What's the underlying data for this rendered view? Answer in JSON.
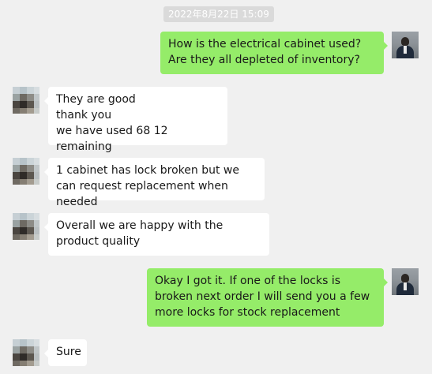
{
  "chat": {
    "timestamp": "2022年8月22日 15:09",
    "messages": [
      {
        "from": "self",
        "text": "How is the electrical cabinet used? Are they all depleted of inventory?"
      },
      {
        "from": "contact",
        "text": "They are good\nthank you\nwe have used 68 12 remaining"
      },
      {
        "from": "contact",
        "text": "1 cabinet has lock broken but we can request replacement when needed"
      },
      {
        "from": "contact",
        "text": "Overall we are happy with the product quality"
      },
      {
        "from": "self",
        "text": "Okay I got it. If one of the locks is broken next order I will send you a few more locks for stock replacement"
      },
      {
        "from": "contact",
        "text": "Sure"
      }
    ]
  },
  "colors": {
    "background": "#f0f0f0",
    "outgoing_bubble": "#95ec69",
    "incoming_bubble": "#ffffff",
    "timestamp_pill": "#dadada"
  }
}
